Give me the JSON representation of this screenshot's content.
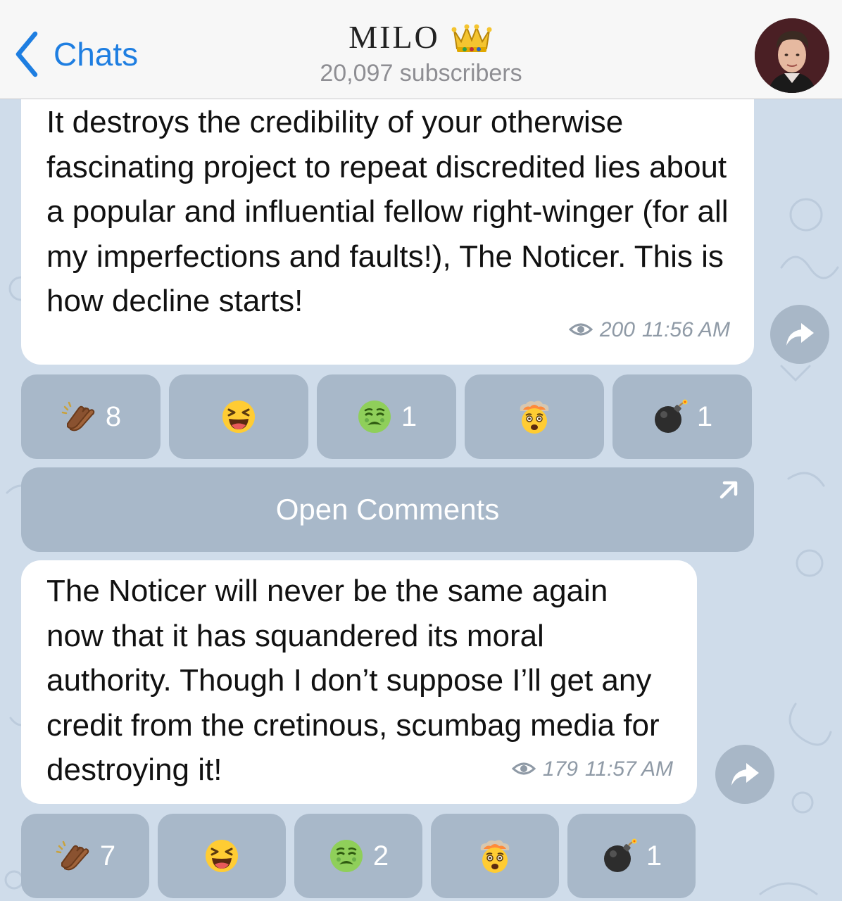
{
  "header": {
    "back_label": "Chats",
    "title": "MILO",
    "subtitle": "20,097 subscribers"
  },
  "messages": [
    {
      "text": "It destroys the credibility of your otherwise fascinating project to repeat discredited lies about a popular and influential fellow right-winger (for all my imperfections and faults!), The Noticer. This is how decline starts!",
      "views": "200",
      "time": "11:56 AM",
      "reactions": [
        {
          "emoji": "clapping-hands",
          "count": "8"
        },
        {
          "emoji": "grinning-squinting-face",
          "count": ""
        },
        {
          "emoji": "nauseated-face",
          "count": "1"
        },
        {
          "emoji": "exploding-head",
          "count": ""
        },
        {
          "emoji": "bomb",
          "count": "1"
        }
      ]
    },
    {
      "text": "The Noticer will never be the same again now that it has squandered its moral authority. Though I don’t suppose I’ll get any credit from the cretinous, scumbag media for destroying it!",
      "views": "179",
      "time": "11:57 AM",
      "reactions": [
        {
          "emoji": "clapping-hands",
          "count": "7"
        },
        {
          "emoji": "grinning-squinting-face",
          "count": ""
        },
        {
          "emoji": "nauseated-face",
          "count": "2"
        },
        {
          "emoji": "exploding-head",
          "count": ""
        },
        {
          "emoji": "bomb",
          "count": "1"
        }
      ]
    }
  ],
  "open_comments_label": "Open Comments",
  "colors": {
    "accent": "#1e7ee1",
    "background": "#cfdcea",
    "reaction_bg": "#a8b8c9",
    "bubble_bg": "#ffffff",
    "meta_text": "#8f9aa6"
  },
  "icons": {
    "back": "chevron-left-icon",
    "crown": "crown-icon",
    "views": "eye-icon",
    "share": "share-arrow-icon",
    "open_comments": "arrow-up-right-icon"
  }
}
